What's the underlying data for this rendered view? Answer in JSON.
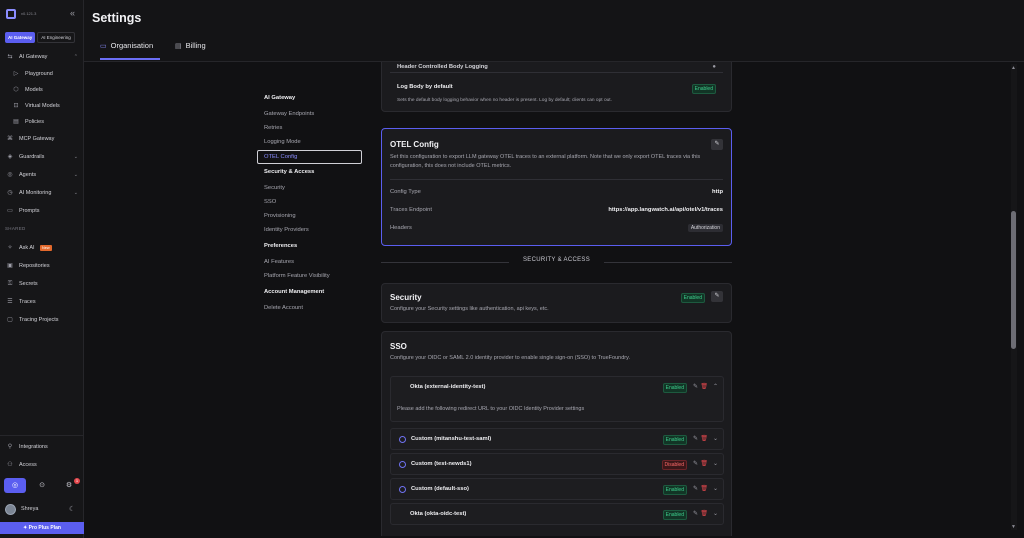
{
  "sidebar": {
    "version": "v0.121.3",
    "segments": [
      "AI Gateway",
      "AI Engineering"
    ],
    "items": [
      {
        "icon": "ai-gateway-icon",
        "glyph": "⇆",
        "label": "AI Gateway",
        "chev": "⌃"
      },
      {
        "icon": "playground-icon",
        "glyph": "▷",
        "label": "Playground"
      },
      {
        "icon": "models-icon",
        "glyph": "⬡",
        "label": "Models"
      },
      {
        "icon": "virtual-models-icon",
        "glyph": "⊡",
        "label": "Virtual Models"
      },
      {
        "icon": "policies-icon",
        "glyph": "▤",
        "label": "Policies"
      },
      {
        "icon": "mcp-gateway-icon",
        "glyph": "⌘",
        "label": "MCP Gateway"
      },
      {
        "icon": "guardrails-icon",
        "glyph": "◈",
        "label": "Guardrails",
        "chev": "⌄"
      },
      {
        "icon": "agents-icon",
        "glyph": "◎",
        "label": "Agents",
        "chev": "⌄"
      },
      {
        "icon": "ai-monitoring-icon",
        "glyph": "◷",
        "label": "AI Monitoring",
        "chev": "⌄"
      },
      {
        "icon": "prompts-icon",
        "glyph": "▭",
        "label": "Prompts"
      },
      {
        "icon": "ask-ai-icon",
        "glyph": "✧",
        "label": "Ask AI",
        "badge": "New"
      },
      {
        "icon": "repositories-icon",
        "glyph": "▣",
        "label": "Repositories"
      },
      {
        "icon": "secrets-icon",
        "glyph": "⚿",
        "label": "Secrets"
      },
      {
        "icon": "traces-icon",
        "glyph": "☰",
        "label": "Traces"
      },
      {
        "icon": "tracing-projects-icon",
        "glyph": "▢",
        "label": "Tracing Projects"
      },
      {
        "icon": "integrations-icon",
        "glyph": "⚲",
        "label": "Integrations"
      },
      {
        "icon": "access-icon",
        "glyph": "⚇",
        "label": "Access"
      }
    ],
    "shared_label": "SHARED",
    "notification_count": "1",
    "user_name": "Shreya",
    "plan": "Pro Plus Plan"
  },
  "header": {
    "title": "Settings",
    "tabs": [
      {
        "label": "Organisation",
        "icon": "organisation-icon"
      },
      {
        "label": "Billing",
        "icon": "billing-icon"
      }
    ]
  },
  "subnav": {
    "groups": [
      {
        "heading": "AI Gateway",
        "items": [
          "Gateway Endpoints",
          "Retries",
          "Logging Mode",
          "OTEL Config"
        ]
      },
      {
        "heading": "Security & Access",
        "items": [
          "Security",
          "SSO",
          "Provisioning",
          "Identity Providers"
        ]
      },
      {
        "heading": "Preferences",
        "items": [
          "AI Features",
          "Platform Feature Visibility"
        ]
      },
      {
        "heading": "Account Management",
        "items": [
          "Delete Account"
        ]
      }
    ],
    "selected": "OTEL Config"
  },
  "logging": {
    "cut_title": "Header Controlled Body Logging",
    "title": "Log Body by default",
    "status": "Enabled",
    "desc": "Sets the default body logging behavior when no header is present. Log by default; clients can opt out."
  },
  "otel": {
    "title": "OTEL Config",
    "desc": "Set this configuration to export LLM gateway OTEL traces to an external platform. Note that we only export OTEL traces via this configuration, this does not include OTEL metrics.",
    "rows": [
      {
        "label": "Config Type",
        "value": "http"
      },
      {
        "label": "Traces Endpoint",
        "value": "https://app.langwatch.ai/api/otel/v1/traces"
      },
      {
        "label": "Headers",
        "value": "Authorization"
      }
    ]
  },
  "section_label": "SECURITY & ACCESS",
  "security": {
    "title": "Security",
    "status": "Enabled",
    "desc": "Configure your Security settings like authentication, api keys, etc."
  },
  "sso": {
    "title": "SSO",
    "desc": "Configure your OIDC or SAML 2.0 identity provider to enable single sign-on (SSO) to TrueFoundry.",
    "redirect_note": "Please add the following redirect URL to your OIDC Identity Provider settings",
    "providers": [
      {
        "name": "Okta (external-identity-test)",
        "status": "Enabled"
      },
      {
        "name": "Custom (mitanshu-test-saml)",
        "status": "Enabled"
      },
      {
        "name": "Custom (test-newds1)",
        "status": "Disabled"
      },
      {
        "name": "Custom (default-sso)",
        "status": "Enabled"
      },
      {
        "name": "Okta (okta-oidc-test)",
        "status": "Enabled"
      }
    ]
  },
  "colors": {
    "accent": "#5b5ef0",
    "enabled": "#3fcf8e",
    "disabled": "#ff6b6b"
  }
}
